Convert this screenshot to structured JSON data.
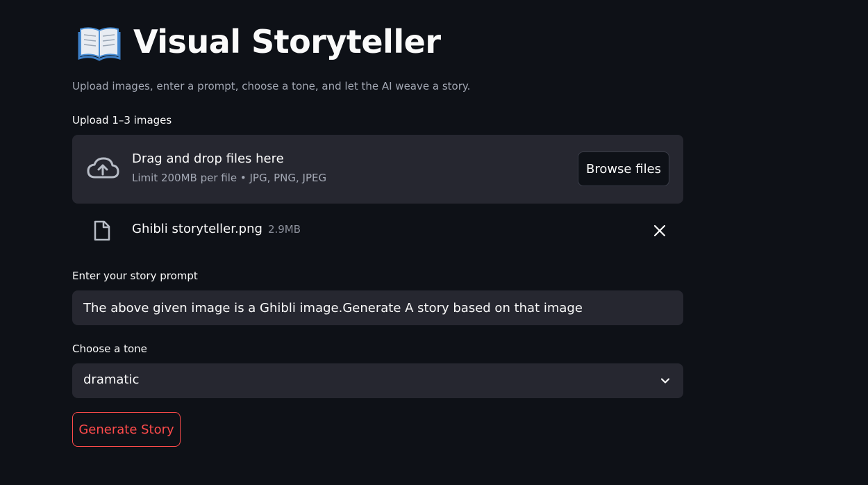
{
  "header": {
    "title": "Visual Storyteller",
    "icon": "open-book-icon",
    "subtitle": "Upload images, enter a prompt, choose a tone, and let the AI weave a story."
  },
  "uploader": {
    "label": "Upload 1–3 images",
    "drop_text": "Drag and drop files here",
    "limit_text": "Limit 200MB per file • JPG, PNG, JPEG",
    "browse_label": "Browse files",
    "icon": "cloud-upload-icon"
  },
  "uploaded_file": {
    "name": "Ghibli storyteller.png",
    "size": "2.9MB",
    "icon": "file-icon",
    "remove_icon": "close-icon"
  },
  "prompt": {
    "label": "Enter your story prompt",
    "value": "The above given image is a Ghibli image.Generate A story based on that image"
  },
  "tone": {
    "label": "Choose a tone",
    "selected": "dramatic",
    "icon": "chevron-down-icon"
  },
  "generate": {
    "label": "Generate Story"
  },
  "colors": {
    "background": "#0e1117",
    "surface": "#262730",
    "accent": "#ff4b4b",
    "muted_text": "#a3a8b4"
  }
}
